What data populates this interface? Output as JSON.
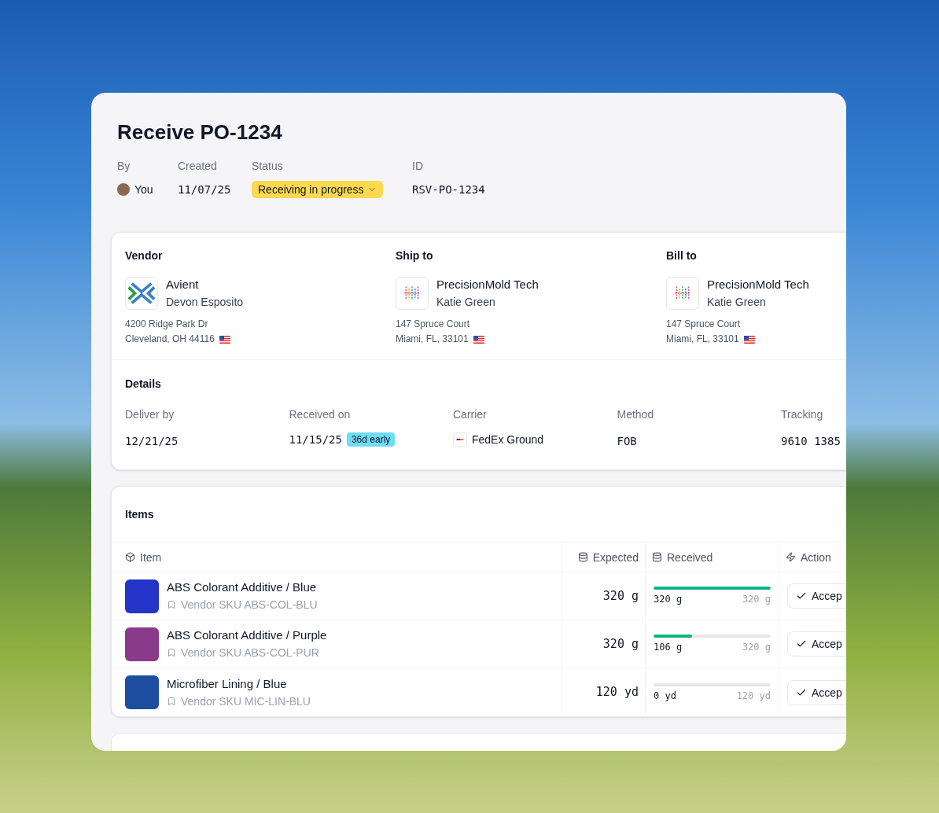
{
  "title": "Receive PO-1234",
  "meta": [
    {
      "kind": "user",
      "label": "By",
      "value": "You"
    },
    {
      "kind": "text",
      "label": "Created",
      "value": "11/07/25"
    },
    {
      "kind": "status",
      "label": "Status",
      "value": "Receiving in progress"
    },
    {
      "kind": "text",
      "label": "ID",
      "value": "RSV-PO-1234"
    }
  ],
  "parties": [
    {
      "kind": "vendor",
      "label": "Vendor",
      "company": "Avient",
      "contact": "Devon Esposito",
      "address": [
        "4200 Ridge Park Dr",
        "Cleveland, OH 44116"
      ]
    },
    {
      "kind": "customer",
      "label": "Ship to",
      "company": "PrecisionMold Tech",
      "contact": "Katie Green",
      "address": [
        "147 Spruce Court",
        "Miami, FL, 33101"
      ]
    },
    {
      "kind": "customer",
      "label": "Bill to",
      "company": "PrecisionMold Tech",
      "contact": "Katie Green",
      "address": [
        "147 Spruce Court",
        "Miami, FL, 33101"
      ]
    }
  ],
  "details": {
    "title": "Details",
    "fields": [
      {
        "kind": "text",
        "label": "Deliver by",
        "value": "12/21/25"
      },
      {
        "kind": "badge",
        "label": "Received on",
        "value": "11/15/25",
        "badge": "36d early"
      },
      {
        "kind": "carrier",
        "label": "Carrier",
        "value": "FedEx Ground"
      },
      {
        "kind": "text",
        "label": "Method",
        "value": "FOB"
      },
      {
        "kind": "text",
        "label": "Tracking",
        "value": "9610 1385"
      }
    ]
  },
  "items": {
    "title": "Items",
    "columns": [
      "Item",
      "Expected",
      "Received",
      "Action"
    ],
    "rows": [
      {
        "name": "ABS Colorant Additive / Blue",
        "sku": "Vendor SKU ABS-COL-BLU",
        "expected": "320 g",
        "received": "320 g",
        "total": "320 g",
        "level": 1,
        "action": "Accep"
      },
      {
        "name": "ABS Colorant Additive / Purple",
        "sku": "Vendor SKU ABS-COL-PUR",
        "expected": "320 g",
        "received": "106 g",
        "total": "320 g",
        "level": 0.33,
        "action": "Accep"
      },
      {
        "name": "Microfiber Lining / Blue",
        "sku": "Vendor SKU MIC-LIN-BLU",
        "expected": "120 yd",
        "received": "0 yd",
        "total": "120 yd",
        "level": 0,
        "action": "Accep"
      }
    ]
  }
}
